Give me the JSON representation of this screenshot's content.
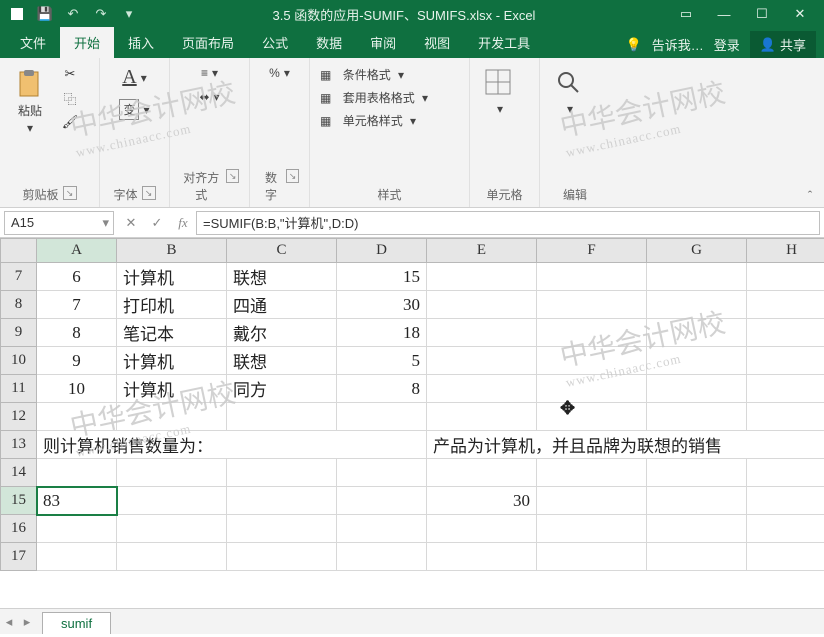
{
  "titlebar": {
    "title": "3.5 函数的应用-SUMIF、SUMIFS.xlsx - Excel"
  },
  "tabs": {
    "file": "文件",
    "home": "开始",
    "insert": "插入",
    "layout": "页面布局",
    "formulas": "公式",
    "data": "数据",
    "review": "审阅",
    "view": "视图",
    "developer": "开发工具",
    "tellme": "告诉我…",
    "signin": "登录",
    "share": "共享"
  },
  "ribbon": {
    "clipboard": {
      "paste": "粘贴",
      "label": "剪贴板"
    },
    "font": {
      "label": "字体"
    },
    "align": {
      "label": "对齐方式"
    },
    "number": {
      "label": "数字"
    },
    "styles": {
      "cond": "条件格式",
      "table": "套用表格格式",
      "cell": "单元格样式",
      "label": "样式"
    },
    "cells": {
      "label": "单元格"
    },
    "editing": {
      "label": "编辑"
    }
  },
  "namebox": "A15",
  "formula": "=SUMIF(B:B,\"计算机\",D:D)",
  "columns": [
    "A",
    "B",
    "C",
    "D",
    "E",
    "F",
    "G",
    "H"
  ],
  "rows": [
    {
      "n": "7",
      "a": "6",
      "b": "计算机",
      "c": "联想",
      "d": "15"
    },
    {
      "n": "8",
      "a": "7",
      "b": "打印机",
      "c": "四通",
      "d": "30"
    },
    {
      "n": "9",
      "a": "8",
      "b": "笔记本",
      "c": "戴尔",
      "d": "18"
    },
    {
      "n": "10",
      "a": "9",
      "b": "计算机",
      "c": "联想",
      "d": "5"
    },
    {
      "n": "11",
      "a": "10",
      "b": "计算机",
      "c": "同方",
      "d": "8"
    },
    {
      "n": "12"
    },
    {
      "n": "13",
      "a_span": "则计算机销售数量为：",
      "e_span": "产品为计算机，并且品牌为联想的销售"
    },
    {
      "n": "14"
    },
    {
      "n": "15",
      "a": "83",
      "e": "30",
      "selected": true
    },
    {
      "n": "16"
    },
    {
      "n": "17"
    }
  ],
  "sheet_tab": "sumif",
  "watermark": {
    "text": "中华会计网校",
    "url": "www.chinaacc.com"
  }
}
